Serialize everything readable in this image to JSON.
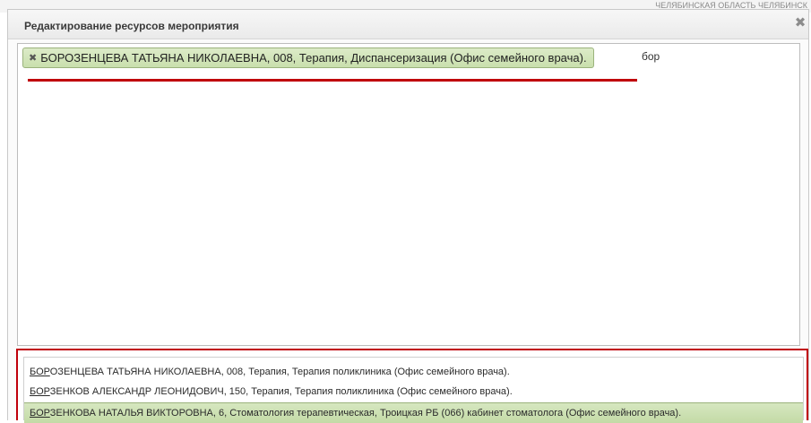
{
  "background": {
    "header_text": "ЧЕЛЯБИНСКАЯ ОБЛАСТЬ ЧЕЛЯБИНСК"
  },
  "dialog": {
    "title": "Редактирование ресурсов мероприятия",
    "close_glyph": "✖"
  },
  "editor": {
    "token": {
      "remove_glyph": "✖",
      "label": "БОРОЗЕНЦЕВА ТАТЬЯНА НИКОЛАЕВНА, 008, Терапия, Диспансеризация (Офис семейного врача)."
    },
    "typed_text": "бор"
  },
  "dropdown": {
    "items": [
      {
        "match": "БОР",
        "rest": "ОЗЕНЦЕВА ТАТЬЯНА НИКОЛАЕВНА, 008, Терапия, Терапия поликлиника (Офис семейного врача)."
      },
      {
        "match": "БОР",
        "rest": "ЗЕНКОВ АЛЕКСАНДР ЛЕОНИДОВИЧ, 150, Терапия, Терапия поликлиника (Офис семейного врача)."
      },
      {
        "match": "БОР",
        "rest": "ЗЕНКОВА НАТАЛЬЯ ВИКТОРОВНА, 6, Стоматология терапевтическая, Троицкая РБ (066) кабинет стоматолога (Офис семейного врача)."
      }
    ]
  },
  "colors": {
    "accent_highlight": "#c0000b",
    "token_green": "#c9dfad"
  }
}
